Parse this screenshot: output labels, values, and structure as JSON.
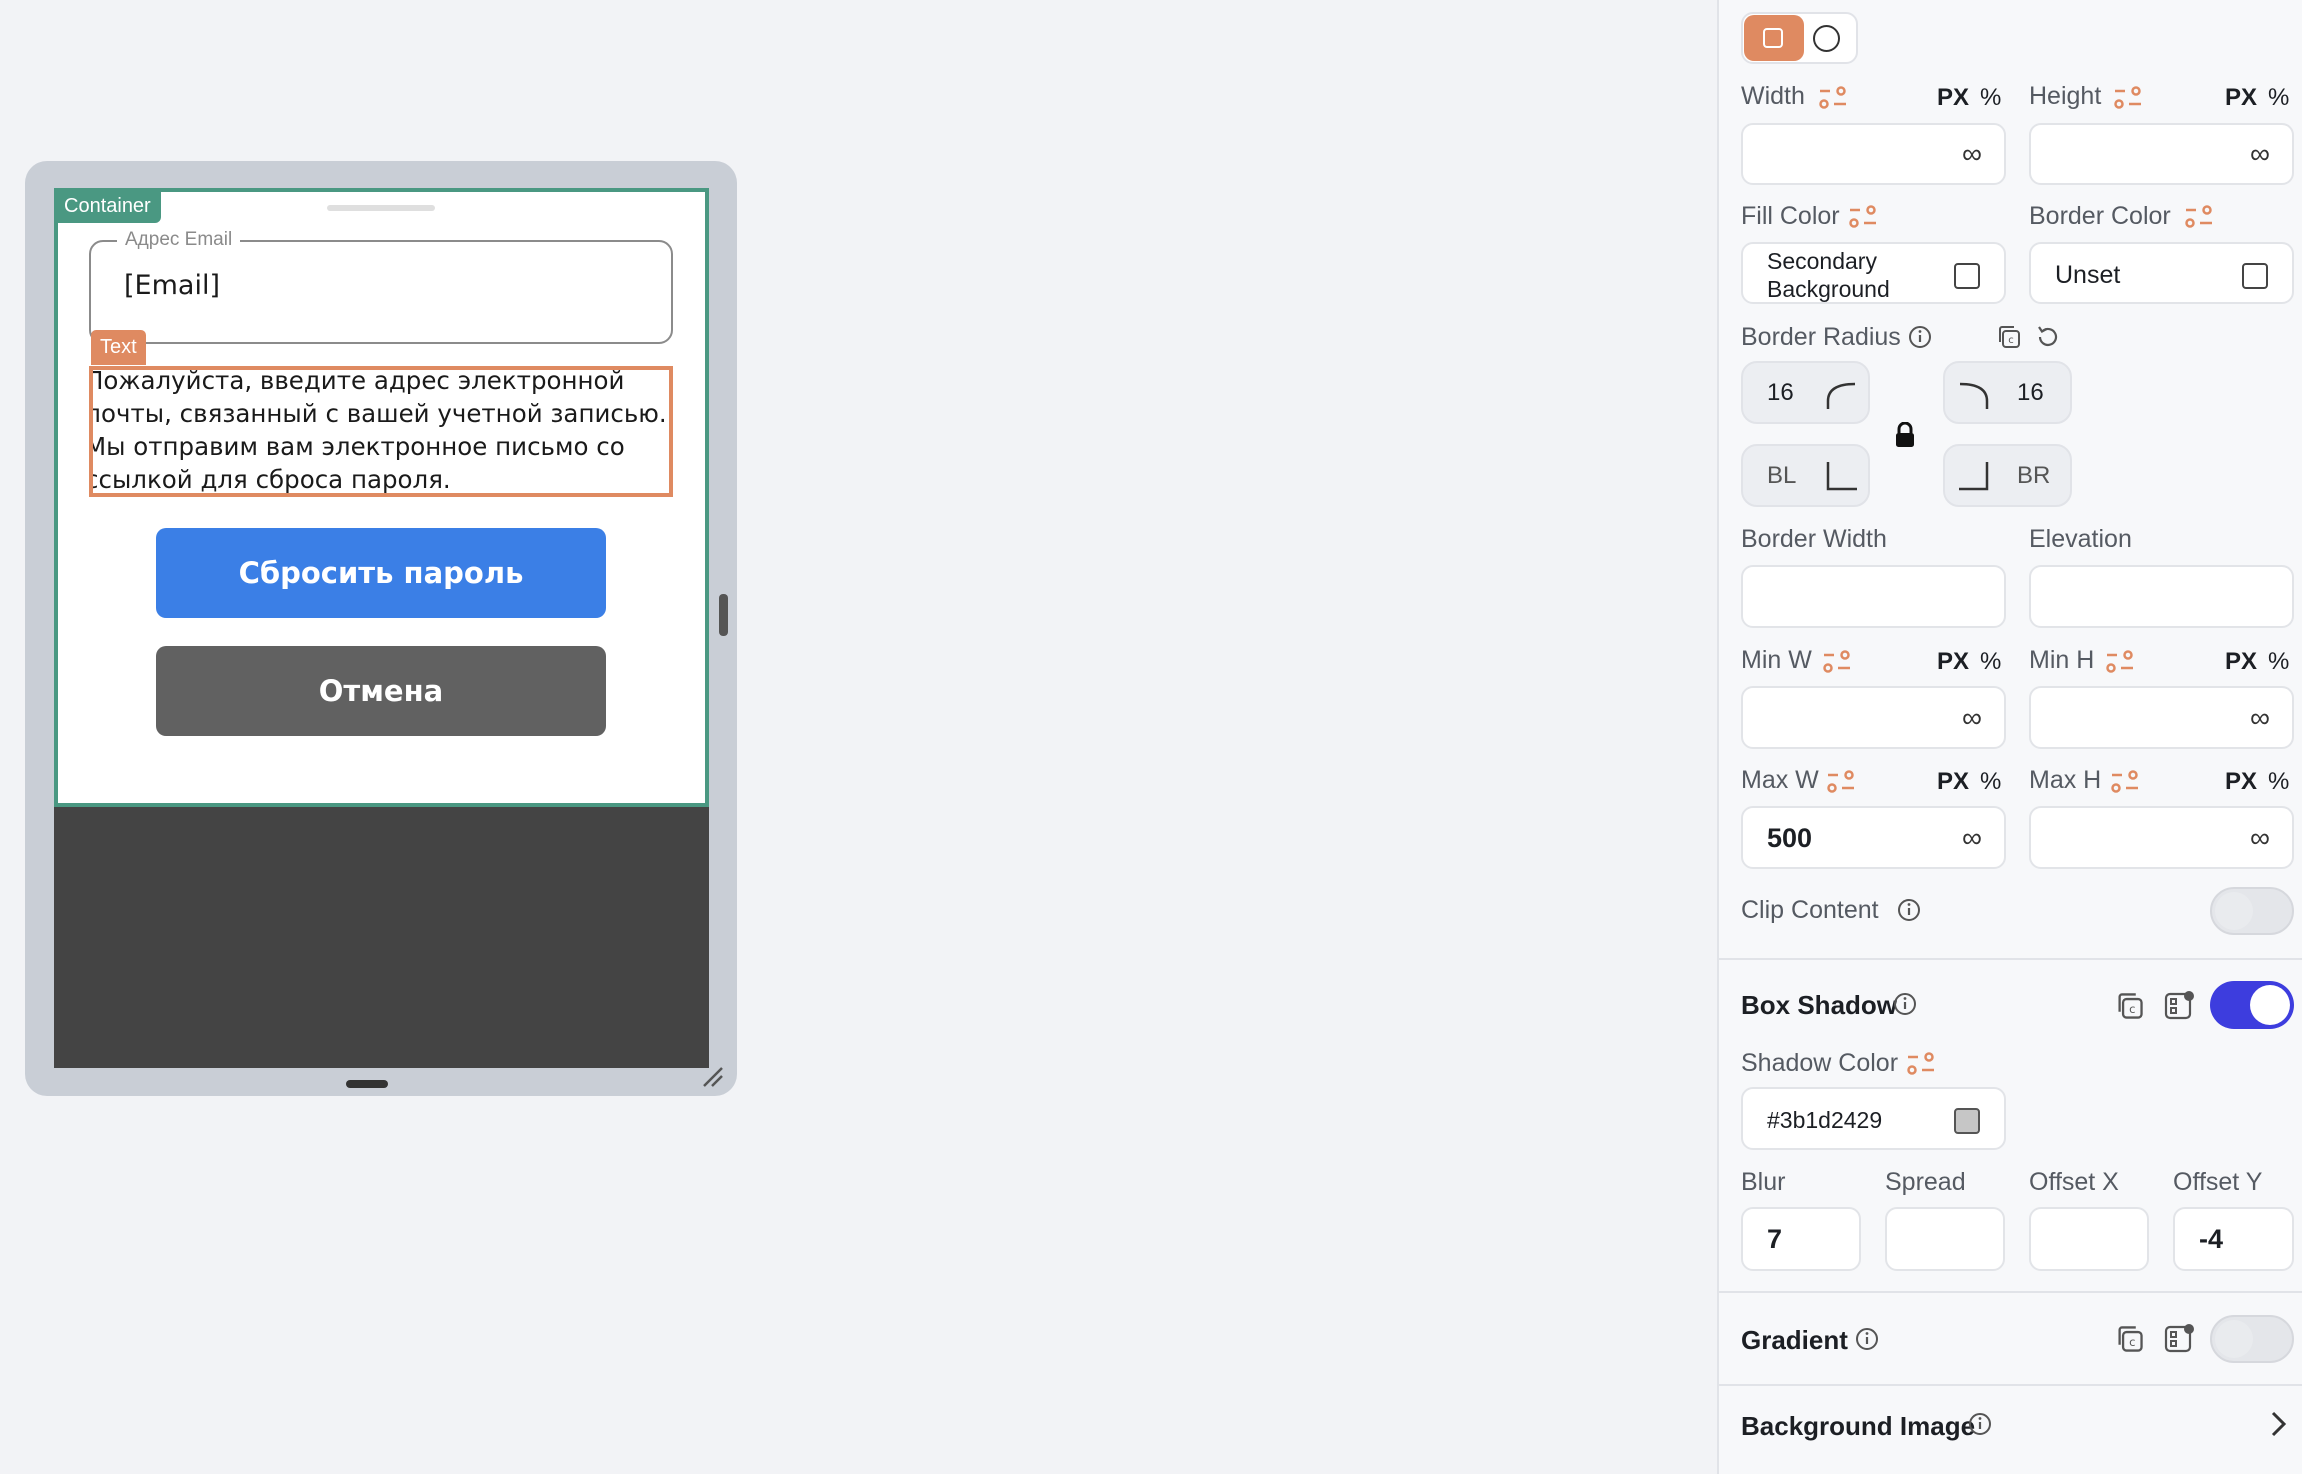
{
  "canvas": {
    "container_tag": "Container",
    "text_tag": "Text",
    "email_field": {
      "label": "Адрес Email",
      "value": "[Email]"
    },
    "description": "Пожалуйста, введите адрес электронной почты, связанный с вашей учетной записью. Мы отправим вам электронное письмо со ссылкой для сброса пароля.",
    "reset_button": "Сбросить пароль",
    "cancel_button": "Отмена"
  },
  "panel": {
    "width": {
      "label": "Width",
      "unit_px": "PX",
      "unit_pct": "%",
      "value": ""
    },
    "height": {
      "label": "Height",
      "unit_px": "PX",
      "unit_pct": "%",
      "value": ""
    },
    "fill_color": {
      "label": "Fill Color",
      "value": "Secondary Background"
    },
    "border_color": {
      "label": "Border Color",
      "value": "Unset"
    },
    "border_radius": {
      "label": "Border Radius",
      "tl": "16",
      "tr": "16",
      "bl": "BL",
      "br": "BR"
    },
    "border_width": {
      "label": "Border Width",
      "value": ""
    },
    "elevation": {
      "label": "Elevation",
      "value": ""
    },
    "min_w": {
      "label": "Min W",
      "unit_px": "PX",
      "unit_pct": "%",
      "value": ""
    },
    "min_h": {
      "label": "Min H",
      "unit_px": "PX",
      "unit_pct": "%",
      "value": ""
    },
    "max_w": {
      "label": "Max W",
      "unit_px": "PX",
      "unit_pct": "%",
      "value": "500"
    },
    "max_h": {
      "label": "Max H",
      "unit_px": "PX",
      "unit_pct": "%",
      "value": ""
    },
    "clip_content": {
      "label": "Clip Content",
      "on": false
    },
    "box_shadow": {
      "label": "Box Shadow",
      "on": true,
      "shadow_color_label": "Shadow Color",
      "shadow_color": "#3b1d2429",
      "blur_label": "Blur",
      "blur": "7",
      "spread_label": "Spread",
      "spread": "",
      "offset_x_label": "Offset X",
      "offset_x": "",
      "offset_y_label": "Offset Y",
      "offset_y": "-4"
    },
    "gradient": {
      "label": "Gradient",
      "on": false
    },
    "background_image": {
      "label": "Background Image"
    },
    "infinity_symbol": "∞"
  },
  "colors": {
    "container_outline": "#4a9882",
    "text_outline": "#df8a61",
    "primary_button": "#3b7fe6",
    "secondary_button": "#616161",
    "toggle_on": "#3d3dde",
    "accent_orange": "#df8a61"
  }
}
